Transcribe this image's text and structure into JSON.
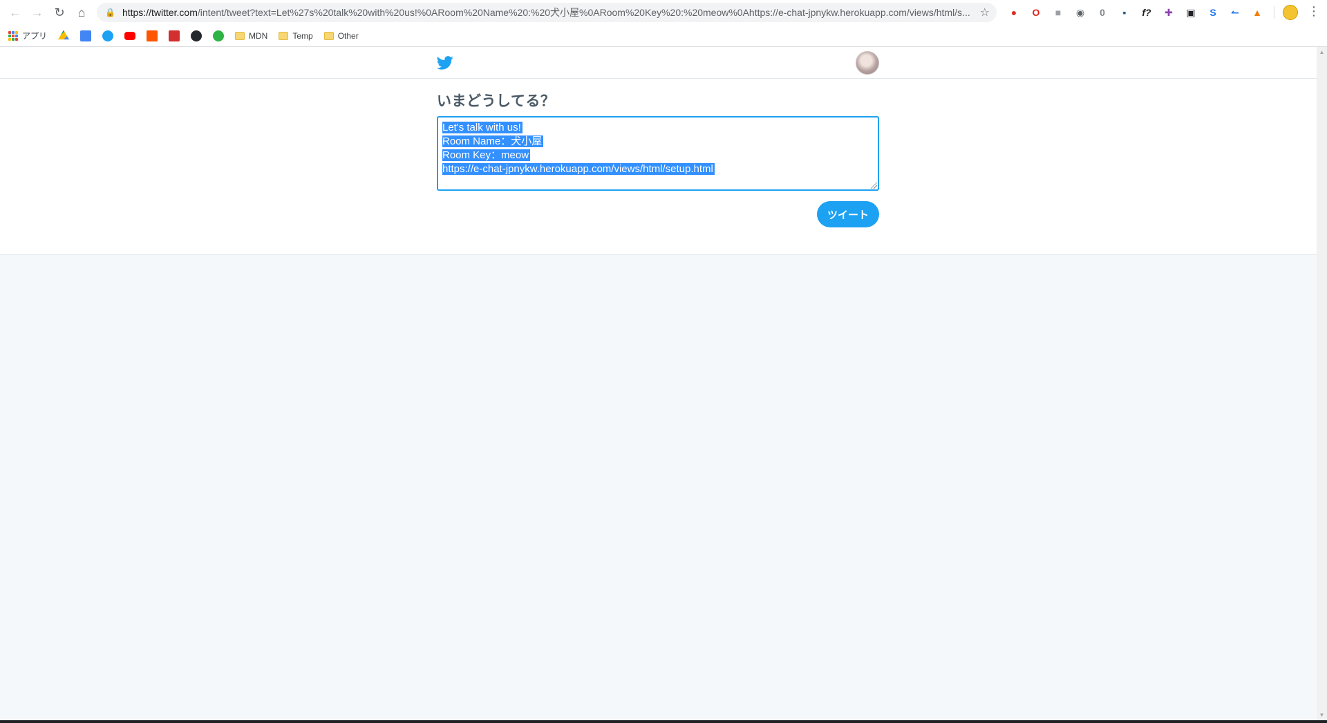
{
  "browser": {
    "url_host": "https://twitter.com",
    "url_rest": "/intent/tweet?text=Let%27s%20talk%20with%20us!%0ARoom%20Name%20:%20犬小屋%0ARoom%20Key%20:%20meow%0Ahttps://e-chat-jpnykw.herokuapp.com/views/html/s...",
    "bookmarks": [
      {
        "label": "アプリ"
      },
      {
        "label": "MDN"
      },
      {
        "label": "Temp"
      },
      {
        "label": "Other"
      }
    ]
  },
  "compose": {
    "prompt": "いまどうしてる？",
    "lines": [
      "Let's talk with us!",
      "Room Name：犬小屋",
      "Room Key：meow",
      "https://e-chat-jpnykw.herokuapp.com/views/html/setup.html"
    ],
    "tweet_button": "ツイート"
  },
  "colors": {
    "twitter_blue": "#1da1f2",
    "selection": "#3390ff",
    "page_bg": "#f5f8fa"
  }
}
